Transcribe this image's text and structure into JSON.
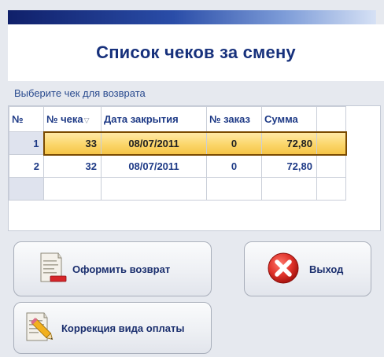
{
  "window": {
    "title": "Список чеков за смену",
    "subtitle": "Выберите чек для возврата"
  },
  "table": {
    "columns": [
      "№",
      "№ чека",
      "Дата закрытия",
      "№ заказ",
      "Сумма",
      ""
    ],
    "rows": [
      {
        "num": "1",
        "check": "33",
        "date": "08/07/2011",
        "order": "0",
        "sum": "72,80",
        "selected": true
      },
      {
        "num": "2",
        "check": "32",
        "date": "08/07/2011",
        "order": "0",
        "sum": "72,80",
        "selected": false
      }
    ]
  },
  "buttons": {
    "return_label": "Оформить возврат",
    "exit_label": "Выход",
    "correction_label": "Коррекция вида оплаты"
  },
  "icons": {
    "sort": "sort-triangle-icon",
    "return": "receipt-minus-icon",
    "exit": "red-close-circle-icon",
    "correction": "receipt-pencil-icon"
  },
  "colors": {
    "title_text": "#17317c",
    "selection": "#fbd66a",
    "exit_red": "#e0332b"
  }
}
